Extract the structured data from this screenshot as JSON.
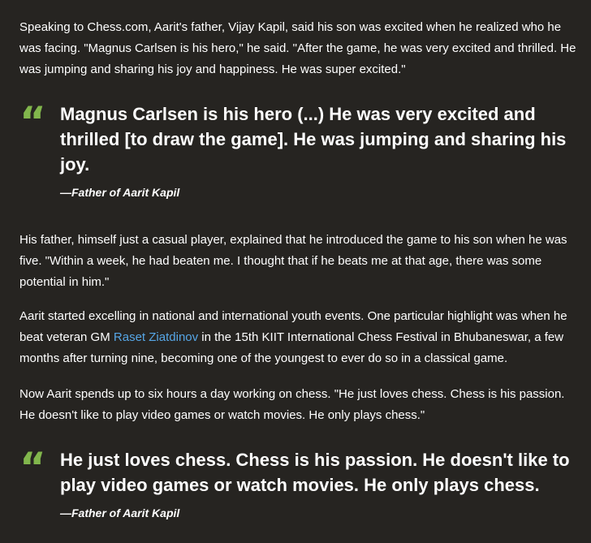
{
  "paragraphs": {
    "p1": "Speaking to Chess.com, Aarit's father, Vijay Kapil, said his son was excited when he realized who he was facing. \"Magnus Carlsen is his hero,\" he said. \"After the game, he was very excited and thrilled. He was jumping and sharing his joy and happiness. He was super excited.\"",
    "p2": "His father, himself just a casual player, explained that he introduced the game to his son when he was five. \"Within a week, he had beaten me. I thought that if he beats me at that age, there was some potential in him.\"",
    "p3_before_link": "Aarit started excelling in national and international youth events. One particular highlight was when he beat veteran GM ",
    "p3_link": "Raset Ziatdinov",
    "p3_after_link": " in the 15th KIIT International Chess Festival in Bhubaneswar, a few months after turning nine, becoming one of the youngest to ever do so in a classical game.",
    "p4": "Now Aarit spends up to six hours a day working on chess. \"He just loves chess. Chess is his passion. He doesn't like to play video games or watch movies. He only plays chess.\""
  },
  "quotes": [
    {
      "mark": "66",
      "text": "Magnus Carlsen is his hero (...) He was very excited and thrilled [to draw the game]. He was jumping and sharing his joy.",
      "source": "—Father of Aarit Kapil"
    },
    {
      "mark": "66",
      "text": "He just loves chess. Chess is his passion. He doesn't like to play video games or watch movies. He only plays chess.",
      "source": "—Father of Aarit Kapil"
    }
  ],
  "colors": {
    "background": "#262421",
    "accent_quote_mark": "#81b64c",
    "link": "#56a6e6",
    "text": "#ffffff"
  }
}
